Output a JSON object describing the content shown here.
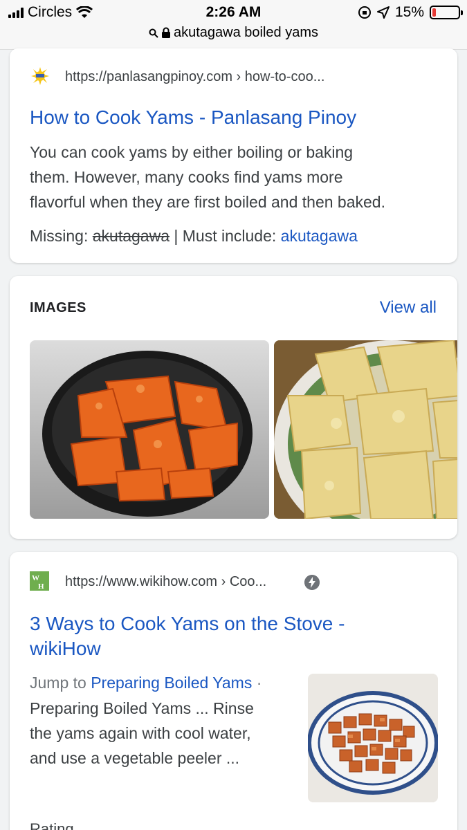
{
  "status_bar": {
    "carrier": "Circles",
    "time": "2:26 AM",
    "battery": "15%",
    "battery_level": 0.15
  },
  "address_bar": {
    "query": "akutagawa boiled yams"
  },
  "results": [
    {
      "url": "https://panlasangpinoy.com › how-to-coo...",
      "title": "How to Cook Yams - Panlasang Pinoy",
      "snippet_lines": [
        "You can cook yams by either boiling or baking",
        "them. However, many cooks find yams more",
        "flavorful when they are first boiled and then baked."
      ],
      "missing_label": "Missing:",
      "missing_term": "akutagawa",
      "must_include_label": "| Must include:",
      "must_include_term": "akutagawa"
    },
    {
      "url": "https://www.wikihow.com › Coo...",
      "title_lines": [
        "3 Ways to Cook Yams on the Stove -",
        "wikiHow"
      ],
      "jump_label": "Jump to",
      "jump_link": "Preparing Boiled Yams",
      "jump_sep": "·",
      "snippet_lines": [
        "Preparing Boiled Yams ... Rinse",
        "the yams again with cool water,",
        "and use a vegetable peeler ..."
      ],
      "favicon_text": "WH"
    }
  ],
  "images_section": {
    "label": "IMAGES",
    "view_all": "View all"
  },
  "footer_partial": "Rating"
}
